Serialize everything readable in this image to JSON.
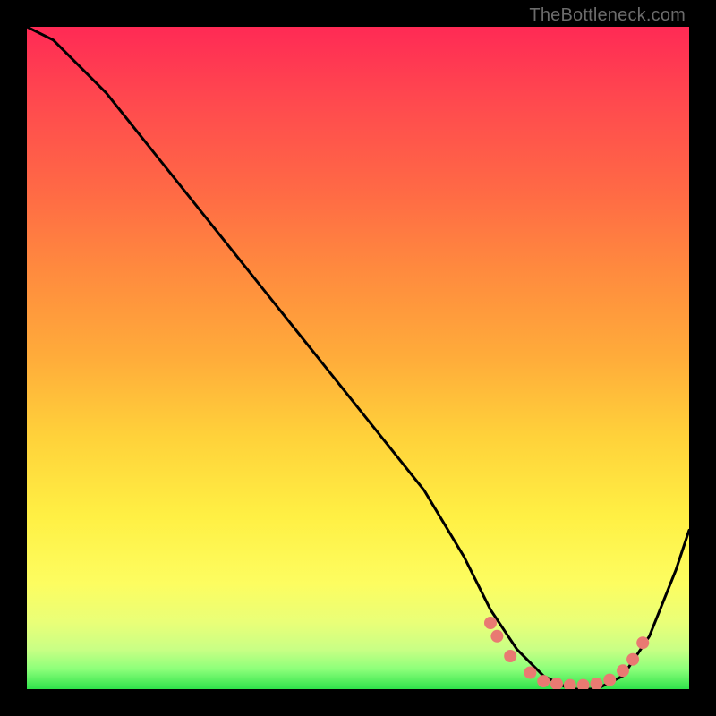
{
  "watermark": "TheBottleneck.com",
  "chart_data": {
    "type": "line",
    "title": "",
    "xlabel": "",
    "ylabel": "",
    "xlim": [
      0,
      100
    ],
    "ylim": [
      0,
      100
    ],
    "series": [
      {
        "name": "bottleneck-curve",
        "x": [
          0,
          4,
          12,
          20,
          28,
          36,
          44,
          52,
          60,
          66,
          70,
          74,
          78,
          82,
          86,
          90,
          94,
          98,
          100
        ],
        "y": [
          100,
          98,
          90,
          80,
          70,
          60,
          50,
          40,
          30,
          20,
          12,
          6,
          2,
          0,
          0,
          2,
          8,
          18,
          24
        ]
      }
    ],
    "markers": {
      "name": "highlight-dots",
      "color": "#e97a72",
      "points": [
        {
          "x": 70,
          "y": 10
        },
        {
          "x": 71,
          "y": 8
        },
        {
          "x": 73,
          "y": 5
        },
        {
          "x": 76,
          "y": 2.5
        },
        {
          "x": 78,
          "y": 1.2
        },
        {
          "x": 80,
          "y": 0.8
        },
        {
          "x": 82,
          "y": 0.6
        },
        {
          "x": 84,
          "y": 0.6
        },
        {
          "x": 86,
          "y": 0.8
        },
        {
          "x": 88,
          "y": 1.4
        },
        {
          "x": 90,
          "y": 2.8
        },
        {
          "x": 91.5,
          "y": 4.5
        },
        {
          "x": 93,
          "y": 7
        }
      ]
    },
    "gradient_stops": [
      {
        "pos": 0,
        "color": "#ff2a55"
      },
      {
        "pos": 25,
        "color": "#ff6a45"
      },
      {
        "pos": 50,
        "color": "#ffac3a"
      },
      {
        "pos": 74,
        "color": "#fff044"
      },
      {
        "pos": 90,
        "color": "#e9ff78"
      },
      {
        "pos": 100,
        "color": "#2fe24a"
      }
    ]
  }
}
